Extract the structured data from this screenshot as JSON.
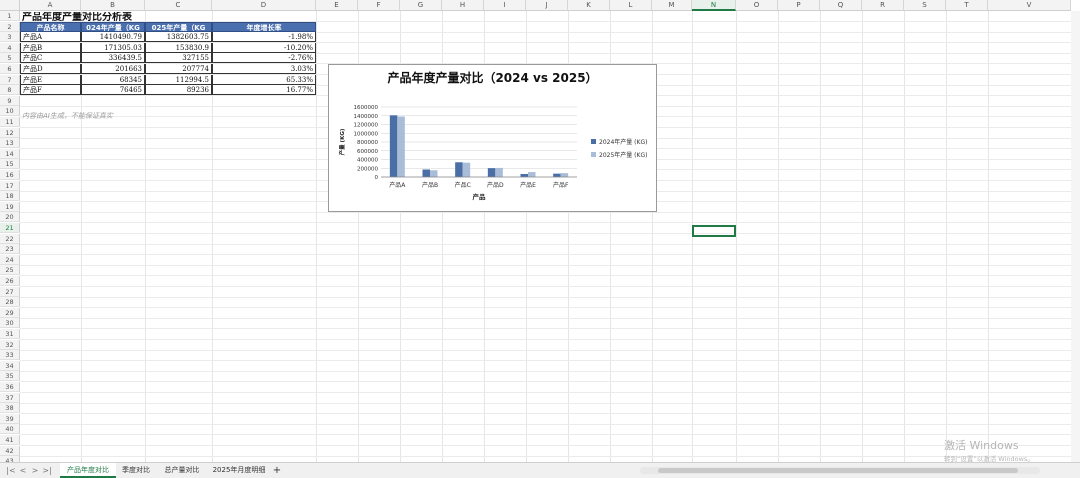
{
  "sheet": {
    "columns": [
      "A",
      "B",
      "C",
      "D",
      "E",
      "F",
      "G",
      "H",
      "I",
      "J",
      "K",
      "L",
      "M",
      "N",
      "O",
      "P",
      "Q",
      "R",
      "S",
      "T",
      "V"
    ],
    "rows": [
      "1",
      "2",
      "3",
      "4",
      "5",
      "6",
      "7",
      "8",
      "9",
      "10",
      "11",
      "12",
      "13",
      "14",
      "15",
      "16",
      "17",
      "18",
      "19",
      "20",
      "21",
      "22",
      "23",
      "24",
      "25",
      "26",
      "27",
      "28",
      "29",
      "30",
      "31",
      "32",
      "33",
      "34",
      "35",
      "36",
      "37",
      "38",
      "39",
      "40",
      "41",
      "42",
      "43"
    ],
    "active_column": "N",
    "active_row": "21"
  },
  "table": {
    "title": "产品年度产量对比分析表",
    "headers": [
      "产品名称",
      "024年产量（KG",
      "025年产量（KG",
      "年度增长率"
    ],
    "rows": [
      [
        "产品A",
        "1410490.79",
        "1382603.75",
        "-1.98%"
      ],
      [
        "产品B",
        "171305.03",
        "153830.9",
        "-10.20%"
      ],
      [
        "产品C",
        "336439.5",
        "327155",
        "-2.76%"
      ],
      [
        "产品D",
        "201663",
        "207774",
        "3.03%"
      ],
      [
        "产品E",
        "68345",
        "112994.5",
        "65.33%"
      ],
      [
        "产品F",
        "76465",
        "89236",
        "16.77%"
      ]
    ],
    "note": "内容由AI生成，不能保证真实"
  },
  "chart_data": {
    "type": "bar",
    "title": "产品年度产量对比（2024 vs 2025）",
    "categories": [
      "产品A",
      "产品B",
      "产品C",
      "产品D",
      "产品E",
      "产品F"
    ],
    "series": [
      {
        "name": "2024年产量 (KG)",
        "values": [
          1410490.79,
          171305.03,
          336439.5,
          201663,
          68345,
          76465
        ]
      },
      {
        "name": "2025年产量 (KG)",
        "values": [
          1382603.75,
          153830.9,
          327155,
          207774,
          112994.5,
          89236
        ]
      }
    ],
    "xlabel": "产品",
    "ylabel": "产量 (KG)",
    "ylim": [
      0,
      1600000
    ],
    "yticks": [
      "0",
      "200000",
      "400000",
      "600000",
      "800000",
      "1000000",
      "1200000",
      "1400000",
      "1600000"
    ],
    "grid": true,
    "legend": "right",
    "colors": [
      "#4a6fa5",
      "#a9bcd8"
    ]
  },
  "tabs": [
    "产品年度对比",
    "季度对比",
    "总产量对比",
    "2025年月度明细"
  ],
  "active_tab": 0,
  "tab_add": "+",
  "nav": [
    "|<",
    "<",
    ">",
    ">|"
  ],
  "watermark": {
    "line1": "激活 Windows",
    "line2": "转到“设置”以激活 Windows。"
  }
}
